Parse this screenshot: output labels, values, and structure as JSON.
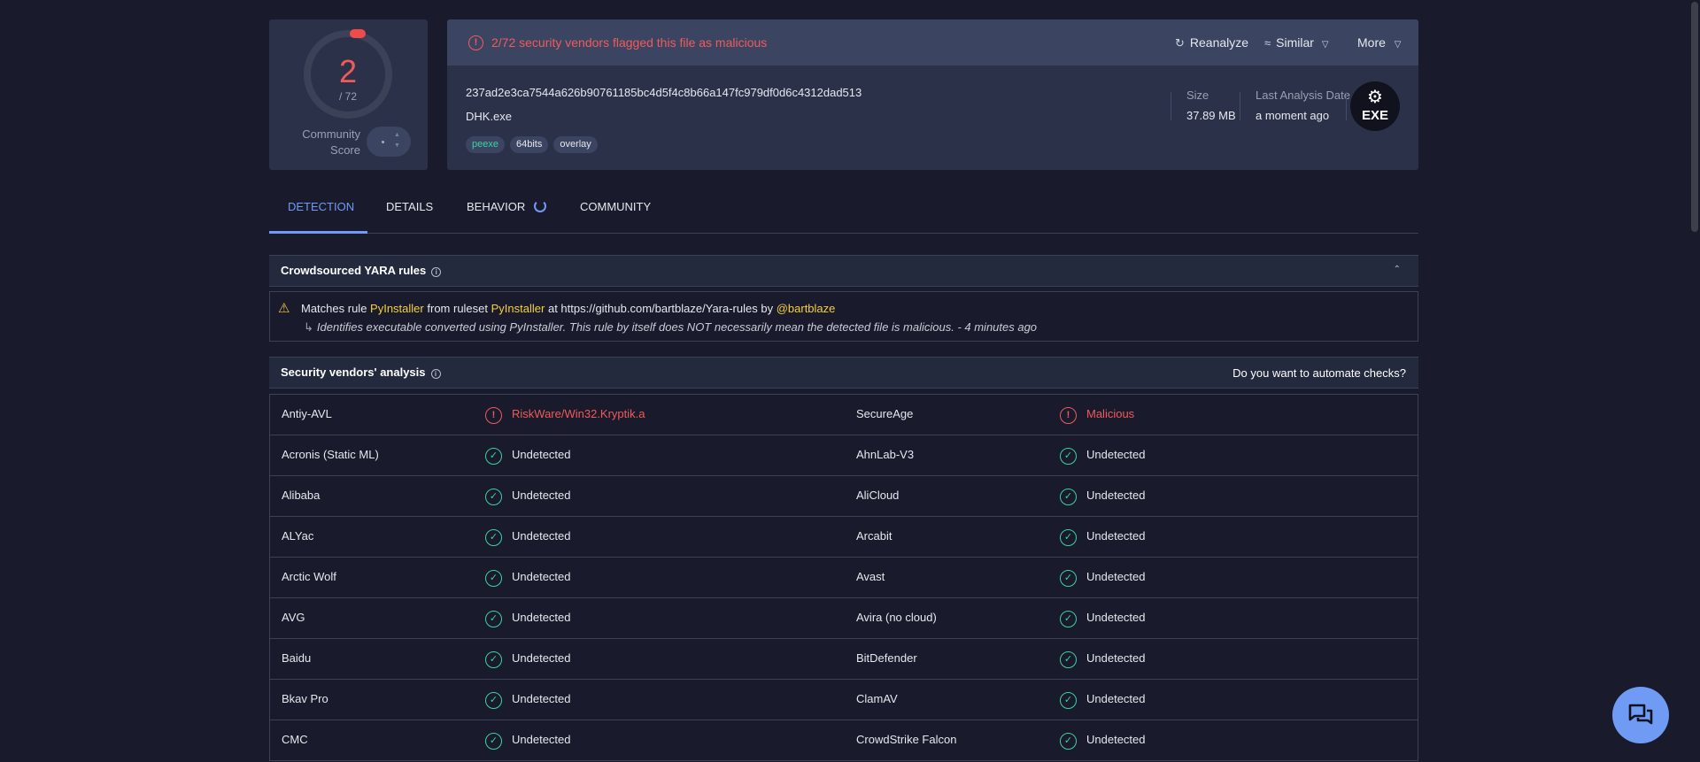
{
  "score": {
    "detections": "2",
    "total": "/ 72",
    "community_label_1": "Community",
    "community_label_2": "Score"
  },
  "alert": {
    "text": "2/72 security vendors flagged this file as malicious"
  },
  "actions": {
    "reanalyze": "Reanalyze",
    "similar": "Similar",
    "more": "More"
  },
  "file": {
    "hash": "237ad2e3ca7544a626b90761185bc4d5f4c8b66a147fc979df0d6c4312dad513",
    "name": "DHK.exe",
    "tags": [
      "peexe",
      "64bits",
      "overlay"
    ],
    "size_label": "Size",
    "size_value": "37.89 MB",
    "last_analysis_label": "Last Analysis Date",
    "last_analysis_value": "a moment ago",
    "type_badge": "EXE"
  },
  "tabs": [
    "DETECTION",
    "DETAILS",
    "BEHAVIOR",
    "COMMUNITY"
  ],
  "yara": {
    "title": "Crowdsourced YARA rules",
    "line_prefix": "Matches rule",
    "rule": "PyInstaller",
    "mid1": "from ruleset",
    "ruleset": "PyInstaller",
    "mid2": "at https://github.com/bartblaze/Yara-rules by",
    "author": "@bartblaze",
    "description": "Identifies executable converted using PyInstaller. This rule by itself does NOT necessarily mean the detected file is malicious. - 4 minutes ago"
  },
  "vendors": {
    "title": "Security vendors' analysis",
    "automate": "Do you want to automate checks?",
    "rows": [
      [
        "Antiy-AVL",
        "RiskWare/Win32.Kryptik.a",
        "SecureAge",
        "Malicious"
      ],
      [
        "Acronis (Static ML)",
        "Undetected",
        "AhnLab-V3",
        "Undetected"
      ],
      [
        "Alibaba",
        "Undetected",
        "AliCloud",
        "Undetected"
      ],
      [
        "ALYac",
        "Undetected",
        "Arcabit",
        "Undetected"
      ],
      [
        "Arctic Wolf",
        "Undetected",
        "Avast",
        "Undetected"
      ],
      [
        "AVG",
        "Undetected",
        "Avira (no cloud)",
        "Undetected"
      ],
      [
        "Baidu",
        "Undetected",
        "BitDefender",
        "Undetected"
      ],
      [
        "Bkav Pro",
        "Undetected",
        "ClamAV",
        "Undetected"
      ],
      [
        "CMC",
        "Undetected",
        "CrowdStrike Falcon",
        "Undetected"
      ]
    ]
  },
  "colors": {
    "malicious": "#ef5b5b",
    "clean": "#3fd1a4",
    "accent": "#6f9bf5",
    "yara_highlight": "#f4d03f"
  }
}
